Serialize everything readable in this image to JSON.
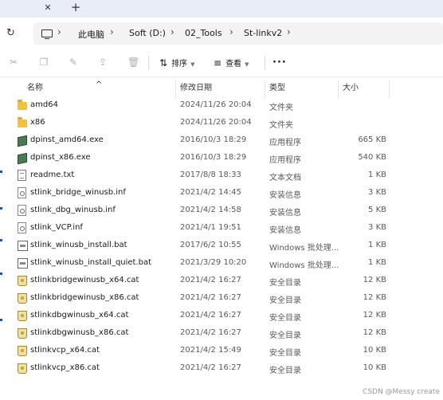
{
  "tabbar": {
    "close_glyph": "✕",
    "add_glyph": "+"
  },
  "address": {
    "refresh_glyph": "↻",
    "breadcrumbs": [
      "此电脑",
      "Soft (D:)",
      "02_Tools",
      "St-linkv2"
    ],
    "separator": "›"
  },
  "toolbar": {
    "icons": [
      "cut-icon",
      "copy-icon",
      "rename-icon",
      "share-icon",
      "delete-icon"
    ],
    "sort_label": "排序",
    "view_label": "查看",
    "more_label": "···"
  },
  "columns": {
    "name": "名称",
    "date": "修改日期",
    "type": "类型",
    "size": "大小"
  },
  "files": [
    {
      "name": "amd64",
      "date": "2024/11/26 20:04",
      "type": "文件夹",
      "size": "",
      "icon": "folder-icon"
    },
    {
      "name": "x86",
      "date": "2024/11/26 20:04",
      "type": "文件夹",
      "size": "",
      "icon": "folder-icon"
    },
    {
      "name": "dpinst_amd64.exe",
      "date": "2016/10/3 18:29",
      "type": "应用程序",
      "size": "665 KB",
      "icon": "exe-icon"
    },
    {
      "name": "dpinst_x86.exe",
      "date": "2016/10/3 18:29",
      "type": "应用程序",
      "size": "540 KB",
      "icon": "exe-icon"
    },
    {
      "name": "readme.txt",
      "date": "2017/8/8 18:33",
      "type": "文本文档",
      "size": "1 KB",
      "icon": "txt-icon"
    },
    {
      "name": "stlink_bridge_winusb.inf",
      "date": "2021/4/2 14:45",
      "type": "安装信息",
      "size": "3 KB",
      "icon": "inf-icon"
    },
    {
      "name": "stlink_dbg_winusb.inf",
      "date": "2021/4/2 14:58",
      "type": "安装信息",
      "size": "5 KB",
      "icon": "inf-icon"
    },
    {
      "name": "stlink_VCP.inf",
      "date": "2021/4/1 19:51",
      "type": "安装信息",
      "size": "3 KB",
      "icon": "inf-icon"
    },
    {
      "name": "stlink_winusb_install.bat",
      "date": "2017/6/2 10:55",
      "type": "Windows 批处理...",
      "size": "1 KB",
      "icon": "bat-icon"
    },
    {
      "name": "stlink_winusb_install_quiet.bat",
      "date": "2021/3/29 10:20",
      "type": "Windows 批处理...",
      "size": "1 KB",
      "icon": "bat-icon"
    },
    {
      "name": "stlinkbridgewinusb_x64.cat",
      "date": "2021/4/2 16:27",
      "type": "安全目录",
      "size": "12 KB",
      "icon": "cat-icon"
    },
    {
      "name": "stlinkbridgewinusb_x86.cat",
      "date": "2021/4/2 16:27",
      "type": "安全目录",
      "size": "12 KB",
      "icon": "cat-icon"
    },
    {
      "name": "stlinkdbgwinusb_x64.cat",
      "date": "2021/4/2 16:27",
      "type": "安全目录",
      "size": "12 KB",
      "icon": "cat-icon"
    },
    {
      "name": "stlinkdbgwinusb_x86.cat",
      "date": "2021/4/2 16:27",
      "type": "安全目录",
      "size": "12 KB",
      "icon": "cat-icon"
    },
    {
      "name": "stlinkvcp_x64.cat",
      "date": "2021/4/2 15:49",
      "type": "安全目录",
      "size": "10 KB",
      "icon": "cat-icon"
    },
    {
      "name": "stlinkvcp_x86.cat",
      "date": "2021/4/2 16:27",
      "type": "安全目录",
      "size": "10 KB",
      "icon": "cat-icon"
    }
  ],
  "watermark": "CSDN @Messy create"
}
